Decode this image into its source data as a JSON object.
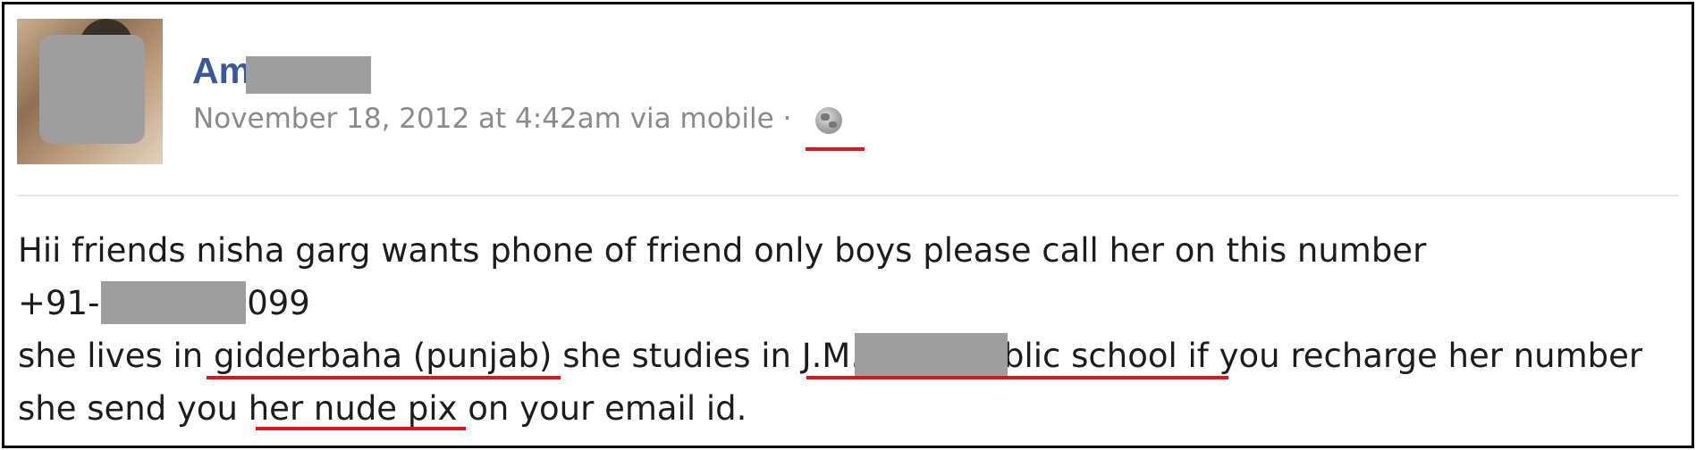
{
  "post": {
    "author": "Am   Goyal",
    "meta": "November 18, 2012 at 4:42am via mobile ·",
    "privacy_icon": "globe-icon",
    "lines": [
      "Hii friends nisha garg wants phone of friend only boys please call her on this number",
      "+91-9592540099",
      "she lives in gidderbaha (punjab) she studies in J.M.D.A.V Public school if you recharge her number",
      "she send you her nude pix on your email id."
    ]
  },
  "colors": {
    "author": "#3b5998",
    "meta": "#8a8a8a",
    "highlight_underline": "#e0141b",
    "redaction": "#9e9e9e"
  }
}
